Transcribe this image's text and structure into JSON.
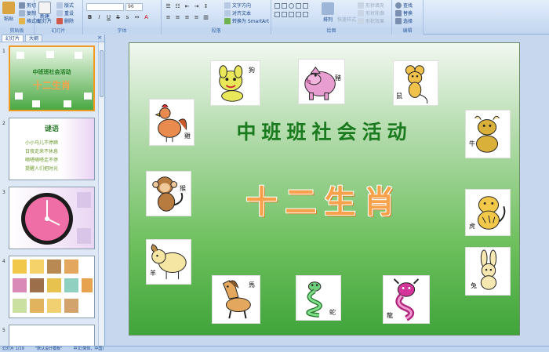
{
  "ribbon": {
    "groups": [
      {
        "id": "clipboard",
        "label": "剪贴板"
      },
      {
        "id": "slides",
        "label": "幻灯片"
      },
      {
        "id": "font",
        "label": "字体"
      },
      {
        "id": "paragraph",
        "label": "段落"
      },
      {
        "id": "drawing",
        "label": "绘图"
      },
      {
        "id": "editing",
        "label": "编辑"
      }
    ],
    "paste": "粘贴",
    "cut": "剪切",
    "copy": "复制",
    "format_painter": "格式刷",
    "new_slide": "新建\n幻灯片",
    "layout": "版式",
    "reset": "重设",
    "delete": "删除",
    "font_size": "96",
    "text_direction": "文字方向",
    "align_text": "对齐文本",
    "convert_smartart": "转换为 SmartArt",
    "arrange": "排列",
    "quick_styles": "快速样式",
    "shape_fill": "形状填充",
    "shape_outline": "形状轮廓",
    "shape_effects": "形状效果",
    "find": "查找",
    "replace": "替换",
    "select": "选择"
  },
  "left_pane": {
    "tab_slides": "幻灯片",
    "tab_outline": "大纲",
    "close": "×",
    "thumbs": [
      {
        "num": "1",
        "title": "中班班社会活动",
        "subtitle": "十二生肖"
      },
      {
        "num": "2",
        "title": "谜语",
        "lines": [
          "小小马儿不停蹄",
          "日夜走来不休息",
          "嘀嗒嘀嗒走不停",
          "提醒人们把时光"
        ]
      },
      {
        "num": "3"
      },
      {
        "num": "4"
      },
      {
        "num": "5"
      }
    ]
  },
  "slide": {
    "heading": "中班班社会活动",
    "title": "十二生肖",
    "animals": [
      {
        "id": "dog",
        "label": "狗"
      },
      {
        "id": "pig",
        "label": "豬"
      },
      {
        "id": "rat",
        "label": "鼠"
      },
      {
        "id": "rooster",
        "label": "雞"
      },
      {
        "id": "ox",
        "label": "牛"
      },
      {
        "id": "monkey",
        "label": "猴"
      },
      {
        "id": "tiger",
        "label": "虎"
      },
      {
        "id": "goat",
        "label": "羊"
      },
      {
        "id": "rabbit",
        "label": "兔"
      },
      {
        "id": "horse",
        "label": "馬"
      },
      {
        "id": "snake",
        "label": "蛇"
      },
      {
        "id": "dragon",
        "label": "龍"
      }
    ]
  },
  "status": {
    "slide_of": "幻灯片 1/19",
    "theme": "\"默认设计模板\"",
    "language": "中文(简体，中国)"
  },
  "colors": {
    "selection": "#f29b24",
    "heading": "#1a7a1e",
    "title": "#f7a24a"
  }
}
